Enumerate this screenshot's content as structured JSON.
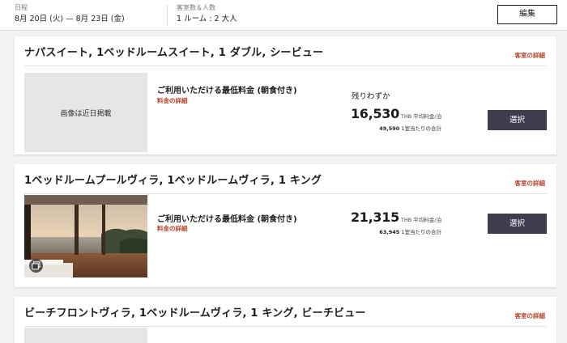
{
  "header": {
    "dates_label": "日程",
    "dates_value": "8月 20日 (火) — 8月 23日 (金)",
    "rooms_label": "客室数＆人数",
    "rooms_value": "1 ルーム : 2 大人",
    "edit_label": "編集"
  },
  "rooms": [
    {
      "title": "ナパスイート, 1ベッドルームスイート, 1 ダブル, シービュー",
      "detail_link": "客室の詳細",
      "image_placeholder": "画像は近日掲載",
      "rate_title": "ご利用いただける最低料金 (朝食付き)",
      "rate_detail": "料金の詳細",
      "availability": "残りわずか",
      "price": "16,530",
      "price_unit": "THB 平均料金/泊",
      "total": "49,590",
      "total_label": "1室当たりの合計",
      "select_label": "選択"
    },
    {
      "title": "1ベッドルームプールヴィラ, 1ベッドルームヴィラ, 1 キング",
      "detail_link": "客室の詳細",
      "rate_title": "ご利用いただける最低料金 (朝食付き)",
      "rate_detail": "料金の詳細",
      "price": "21,315",
      "price_unit": "THB 平均料金/泊",
      "total": "63,945",
      "total_label": "1室当たりの合計",
      "select_label": "選択"
    },
    {
      "title": "ビーチフロントヴィラ, 1ベッドルームヴィラ, 1 キング, ビーチビュー",
      "detail_link": "客室の詳細"
    }
  ],
  "icons": {
    "gallery": "gallery-icon"
  },
  "colors": {
    "accent_link": "#b5452a",
    "select_button": "#3f3c4f",
    "background": "#f2f2f2"
  }
}
